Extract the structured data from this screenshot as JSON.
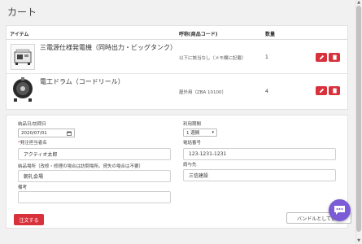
{
  "page": {
    "title": "カート"
  },
  "cart": {
    "columns": {
      "item": "アイテム",
      "name_code": "呼称(商品コード)",
      "qty": "数量"
    },
    "items": [
      {
        "name": "三電源仕様発電機（同時出力・ビッグタンク）",
        "code": "以下に該当なし（メモ欄に記載）",
        "qty": "1",
        "image_icon": "generator-icon"
      },
      {
        "name": "電工ドラム（コードリール）",
        "code": "屋外用（ZBA 10100）",
        "qty": "4",
        "image_icon": "cord-reel-icon"
      }
    ]
  },
  "form": {
    "delivery_date_label": "納品日/訪問日",
    "delivery_date_value": "2020/07/01",
    "rental_period_label": "利用期間",
    "rental_period_value": "1 週間",
    "orderer_label": "発注担当者名",
    "orderer_value": "アクティオ太郎",
    "phone_label": "電話番号",
    "phone_value": "123-1231-1231",
    "place_label": "納品場所（改修・修理の場合は訪問場所。貸失の場合は不要）",
    "place_value": "朝礼会場",
    "bill_to_label": "請与先",
    "bill_to_value": "三信建設",
    "note_label": "備考",
    "note_value": ""
  },
  "actions": {
    "order_label": "注文する",
    "bundle_label": "バンドルとして保存"
  },
  "colors": {
    "accent_red": "#d9313b",
    "chat_purple": "#7b5cd6"
  }
}
